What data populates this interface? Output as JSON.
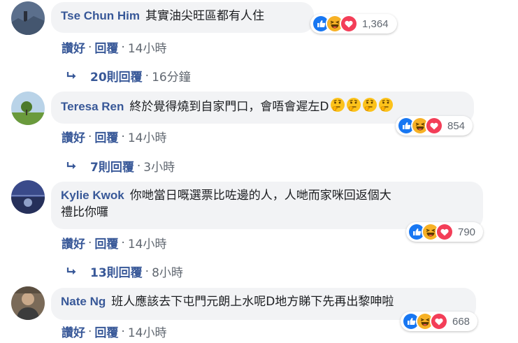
{
  "colors": {
    "link": "#385898",
    "meta": "#606770",
    "bubble": "#f2f3f5",
    "like": "#1877f2",
    "haha": "#f7b125",
    "love": "#f33e58"
  },
  "comments": [
    {
      "author": "Tse Chun Him",
      "text": "其實油尖旺區都有人住",
      "emojis": [],
      "reactions": [
        "like-icon",
        "haha-icon",
        "love-icon"
      ],
      "reaction_count": "1,364",
      "actions": {
        "like": "讚好",
        "reply": "回覆",
        "time": "14小時"
      },
      "replies": {
        "label": "20則回覆",
        "time": "16分鐘"
      }
    },
    {
      "author": "Teresa Ren",
      "text": "終於覺得燒到自家門口，會唔會遲左D",
      "emojis": [
        "thinking-emoji",
        "thinking-emoji",
        "thinking-emoji",
        "thinking-emoji"
      ],
      "reactions": [
        "like-icon",
        "haha-icon",
        "love-icon"
      ],
      "reaction_count": "854",
      "actions": {
        "like": "讚好",
        "reply": "回覆",
        "time": "14小時"
      },
      "replies": {
        "label": "7則回覆",
        "time": "3小時"
      }
    },
    {
      "author": "Kylie Kwok",
      "text_line1": "你哋當日嘅選票比咗邊的人，人哋而家咪回返個大",
      "text_line2": "禮比你囉",
      "reactions": [
        "like-icon",
        "haha-icon",
        "love-icon"
      ],
      "reaction_count": "790",
      "actions": {
        "like": "讚好",
        "reply": "回覆",
        "time": "14小時"
      },
      "replies": {
        "label": "13則回覆",
        "time": "8小時"
      }
    },
    {
      "author": "Nate Ng",
      "text": "班人應該去下屯門元朗上水呢D地方睇下先再出黎呻啦",
      "reactions": [
        "like-icon",
        "haha-icon",
        "love-icon"
      ],
      "reaction_count": "668",
      "actions": {
        "like": "讚好",
        "reply": "回覆",
        "time": "14小時"
      }
    }
  ]
}
